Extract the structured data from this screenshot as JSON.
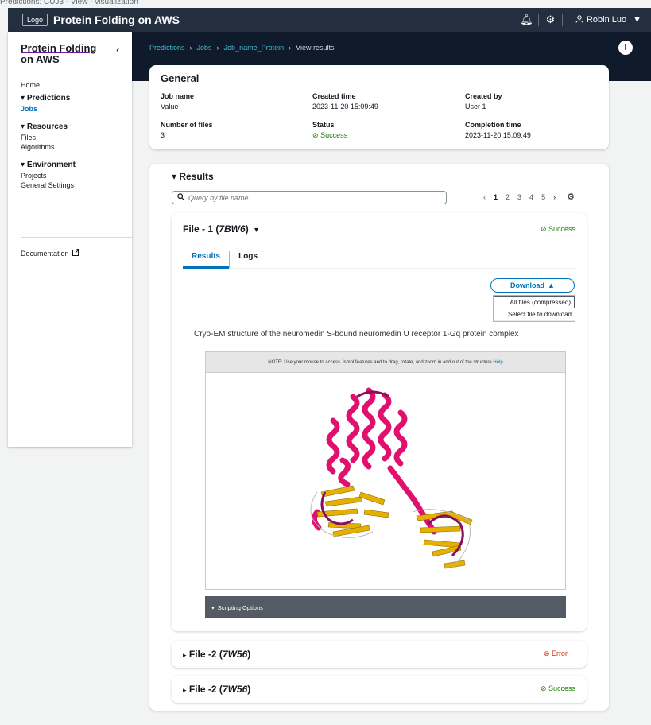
{
  "caption": "Predictions: CUJ3 - View - visualization",
  "topnav": {
    "logo": "Logo",
    "title": "Protein Folding on AWS",
    "notification_icon": "bell-icon",
    "settings_icon": "gear-icon",
    "user_icon": "user-icon",
    "user_name": "Robin Luo",
    "user_caret": "▼"
  },
  "breadcrumb": [
    "Predictions",
    "Jobs",
    "Job_name_Protein",
    "View results"
  ],
  "sidebar": {
    "title": "Protein Folding on AWS",
    "home": "Home",
    "predictions": "Predictions",
    "jobs": "Jobs",
    "resources": "Resources",
    "files": "Files",
    "algorithms": "Algorithms",
    "environment": "Environment",
    "projects": "Projects",
    "general_settings": "General Settings",
    "documentation": "Documentation"
  },
  "general": {
    "title": "General",
    "job_name_label": "Job name",
    "job_name": "Value",
    "created_time_label": "Created time",
    "created_time": "2023-11-20 15:09:49",
    "created_by_label": "Created by",
    "created_by": "User 1",
    "num_files_label": "Number of files",
    "num_files": "3",
    "status_label": "Status",
    "status": "Success",
    "completion_time_label": "Completion time",
    "completion_time": "2023-11-20 15:09:49"
  },
  "results": {
    "title": "Results",
    "search_placeholder": "Query by file name",
    "pages": [
      "1",
      "2",
      "3",
      "4",
      "5"
    ],
    "current_page": "1"
  },
  "file1": {
    "title_prefix": "File - 1 (",
    "code": "7BW6",
    "title_suffix": ")",
    "status": "Success",
    "tab_results": "Results",
    "tab_logs": "Logs",
    "download": "Download",
    "menu_all": "All files (compressed)",
    "menu_select": "Select file to download",
    "viewer_title": "Cryo-EM structure of the neuromedin S-bound neuromedin U receptor 1-Gq protein complex",
    "viewer_note": "NOTE: Use your mouse to access Jsmol features and to drag, rotate, and zoom in and out of the structure.",
    "viewer_help": "Help",
    "scripting": "Scripting Options"
  },
  "file2": {
    "title_prefix": "File -2 (",
    "code": "7W56",
    "title_suffix": ")",
    "status": "Error"
  },
  "file3": {
    "title_prefix": "File -2 (",
    "code": "7W56",
    "title_suffix": ")",
    "status": "Success"
  },
  "colors": {
    "link": "#0073bb",
    "success": "#1d8102",
    "error": "#d13212",
    "header": "#232f3e",
    "helix": "#e0116e",
    "sheet": "#e6b000",
    "coil": "#8a0f5c"
  }
}
